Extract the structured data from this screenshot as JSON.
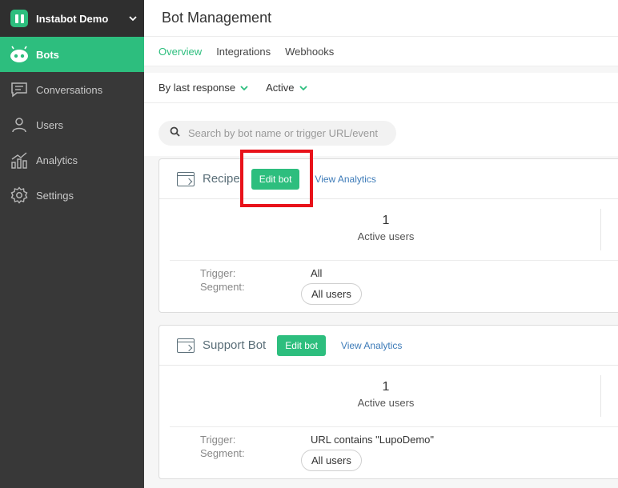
{
  "brand": {
    "name": "Instabot Demo"
  },
  "sidebar": {
    "items": [
      {
        "label": "Bots",
        "icon": "bot-icon",
        "active": true
      },
      {
        "label": "Conversations",
        "icon": "chat-icon"
      },
      {
        "label": "Users",
        "icon": "user-icon"
      },
      {
        "label": "Analytics",
        "icon": "analytics-icon"
      },
      {
        "label": "Settings",
        "icon": "gear-icon"
      }
    ]
  },
  "header": {
    "title": "Bot Management"
  },
  "tabs": [
    {
      "label": "Overview",
      "active": true
    },
    {
      "label": "Integrations"
    },
    {
      "label": "Webhooks"
    }
  ],
  "filters": {
    "sort_label": "By last response",
    "status_label": "Active"
  },
  "search": {
    "placeholder": "Search by bot name or trigger URL/event"
  },
  "bots": [
    {
      "name": "Recipe",
      "edit_label": "Edit bot",
      "analytics_label": "View Analytics",
      "active_users_value": "1",
      "active_users_label": "Active users",
      "trigger_label": "Trigger:",
      "trigger_value": "All",
      "segment_label": "Segment:",
      "segment_value": "All users"
    },
    {
      "name": "Support Bot",
      "edit_label": "Edit bot",
      "analytics_label": "View Analytics",
      "active_users_value": "1",
      "active_users_label": "Active users",
      "trigger_label": "Trigger:",
      "trigger_value": "URL contains \"LupoDemo\"",
      "segment_label": "Segment:",
      "segment_value": "All users"
    }
  ],
  "colors": {
    "accent": "#2dbe7e",
    "sidebar": "#383838",
    "link": "#3d7bb8",
    "highlight": "#e8121a"
  }
}
